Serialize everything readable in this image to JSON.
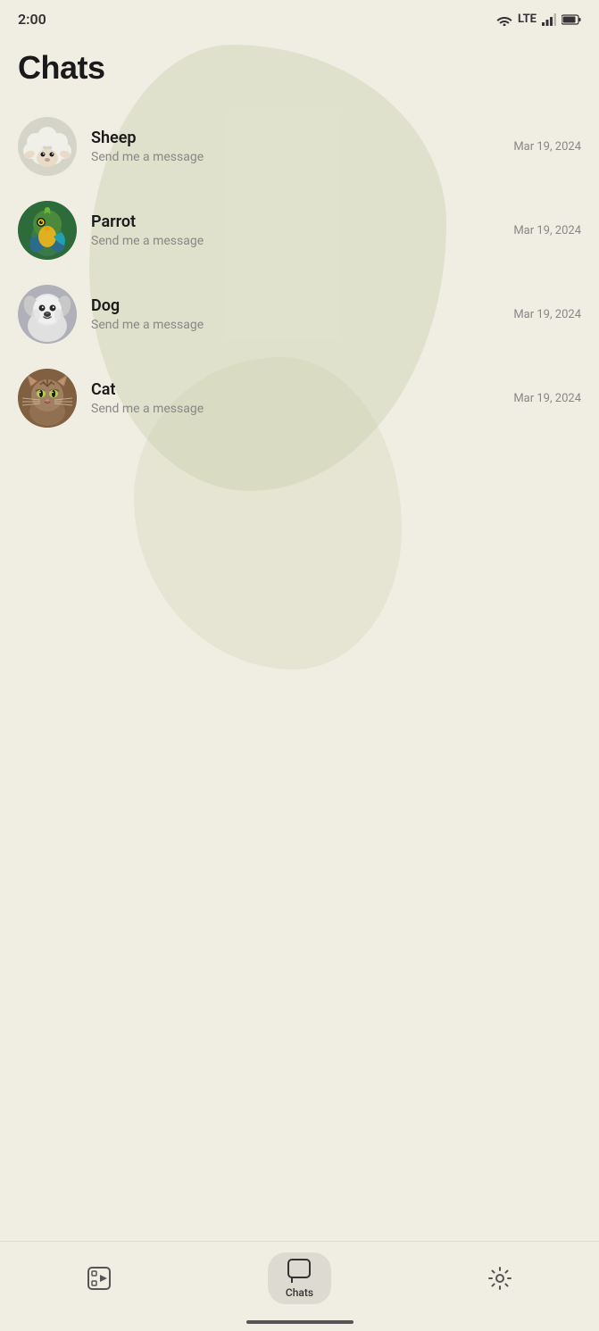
{
  "statusBar": {
    "time": "2:00",
    "indicators": [
      "wifi",
      "lte",
      "signal",
      "battery"
    ]
  },
  "header": {
    "title": "Chats"
  },
  "chats": [
    {
      "id": "sheep",
      "name": "Sheep",
      "preview": "Send me a message",
      "date": "Mar 19, 2024",
      "avatarType": "sheep"
    },
    {
      "id": "parrot",
      "name": "Parrot",
      "preview": "Send me a message",
      "date": "Mar 19, 2024",
      "avatarType": "parrot"
    },
    {
      "id": "dog",
      "name": "Dog",
      "preview": "Send me a message",
      "date": "Mar 19, 2024",
      "avatarType": "dog"
    },
    {
      "id": "cat",
      "name": "Cat",
      "preview": "Send me a message",
      "date": "Mar 19, 2024",
      "avatarType": "cat"
    }
  ],
  "bottomNav": {
    "items": [
      {
        "id": "stories",
        "label": "",
        "icon": "play-square"
      },
      {
        "id": "chats",
        "label": "Chats",
        "icon": "chat",
        "active": true
      },
      {
        "id": "settings",
        "label": "",
        "icon": "gear"
      }
    ]
  }
}
